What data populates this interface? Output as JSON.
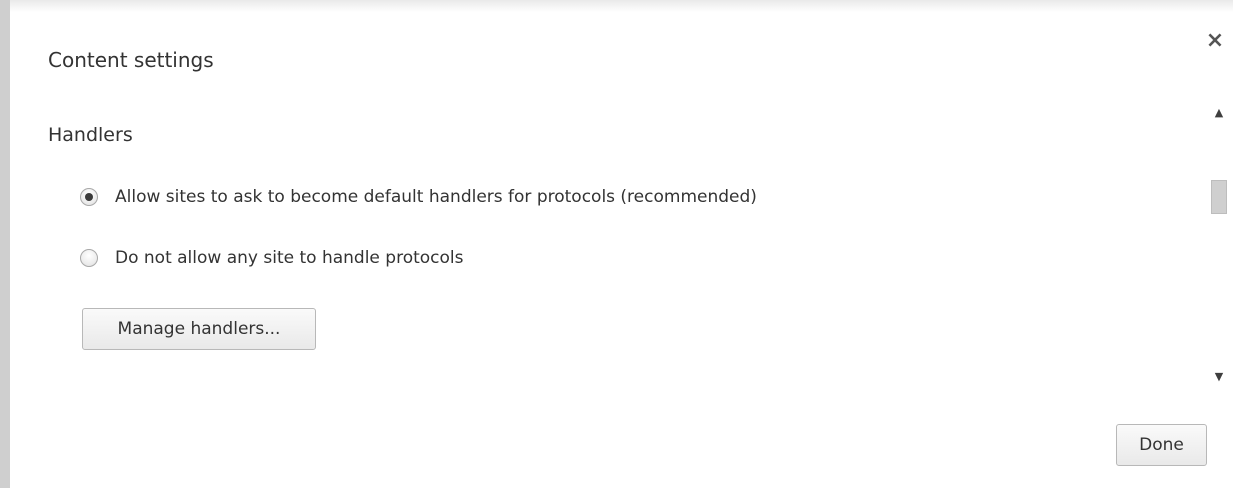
{
  "dialog": {
    "title": "Content settings",
    "close_icon": "close-icon",
    "close_glyph": "×"
  },
  "section": {
    "title": "Handlers",
    "options": [
      {
        "label": "Allow sites to ask to become default handlers for protocols (recommended)",
        "selected": true
      },
      {
        "label": "Do not allow any site to handle protocols",
        "selected": false
      }
    ],
    "manage_button_label": "Manage handlers..."
  },
  "footer": {
    "done_label": "Done"
  },
  "scrollbar": {
    "up_glyph": "▲",
    "down_glyph": "▼"
  }
}
